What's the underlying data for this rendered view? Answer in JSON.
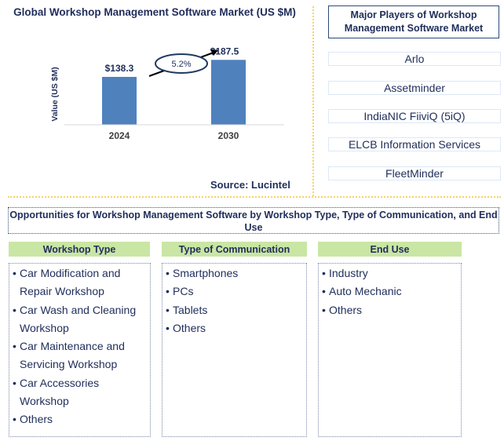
{
  "chart_data": {
    "type": "bar",
    "title": "Global Workshop Management Software Market (US $M)",
    "xlabel": "",
    "ylabel": "Value (US $M)",
    "categories": [
      "2024",
      "2030"
    ],
    "values": [
      138.3,
      187.5
    ],
    "data_labels": [
      "$138.3",
      "$187.5"
    ],
    "ylim": [
      0,
      200
    ],
    "grid": false,
    "annotation": {
      "text": "5.2%",
      "meaning": "CAGR 2024-2030"
    },
    "bar_color": "#4f81bd",
    "source": "Source: Lucintel"
  },
  "players": {
    "title": "Major Players of Workshop Management Software Market",
    "items": [
      "Arlo",
      "Assetminder",
      "IndiaNIC FiiviQ (5iQ)",
      "ELCB Information Services",
      "FleetMinder"
    ]
  },
  "opportunities": {
    "title": "Opportunities for Workshop Management Software by Workshop Type, Type of Communication, and End Use",
    "columns": [
      {
        "header": "Workshop Type",
        "items": [
          "Car Modification and Repair Workshop",
          "Car Wash and Cleaning Workshop",
          "Car Maintenance and Servicing Workshop",
          "Car Accessories Workshop",
          "Others"
        ]
      },
      {
        "header": "Type of Communication",
        "items": [
          "Smartphones",
          "PCs",
          "Tablets",
          "Others"
        ]
      },
      {
        "header": "End Use",
        "items": [
          "Industry",
          "Auto Mechanic",
          "Others"
        ]
      }
    ],
    "bullet": "•",
    "header_color": "#c9e6a4"
  }
}
